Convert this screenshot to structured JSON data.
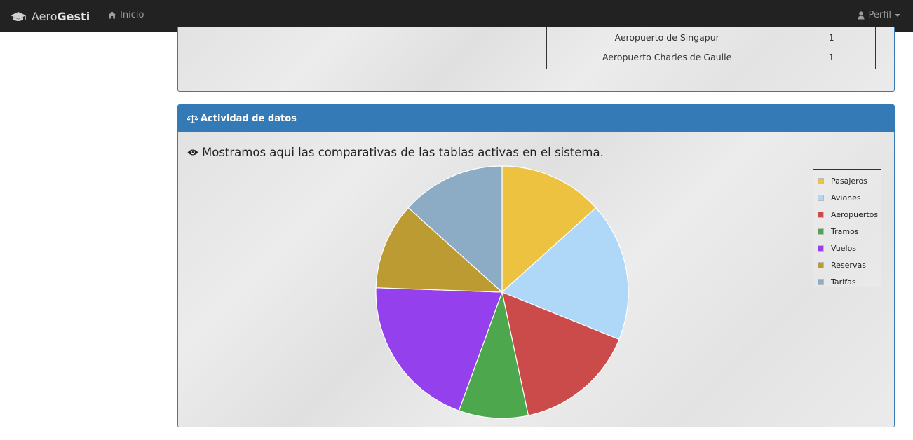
{
  "navbar": {
    "brand_prefix": "Aero",
    "brand_suffix": "Gesti",
    "home_label": "Inicio",
    "profile_label": "Perfil"
  },
  "airports_table": {
    "rows": [
      {
        "name": "Aeropuerto de Singapur",
        "count": "1"
      },
      {
        "name": "Aeropuerto Charles de Gaulle",
        "count": "1"
      }
    ]
  },
  "activity_panel": {
    "title": "Actividad de datos",
    "subtitle": "Mostramos aqui las comparativas de las tablas activas en el sistema."
  },
  "colors": {
    "primary": "#337ab7",
    "navbar": "#222222"
  },
  "chart_data": {
    "type": "pie",
    "title": "",
    "legend_position": "top-right",
    "slices": [
      {
        "label": "Pasajeros",
        "value": 3,
        "color": "#EDC240"
      },
      {
        "label": "Aviones",
        "value": 4,
        "color": "#AFD8F8"
      },
      {
        "label": "Aeropuertos",
        "value": 3.5,
        "color": "#CB4B4B"
      },
      {
        "label": "Tramos",
        "value": 2,
        "color": "#4DA74D"
      },
      {
        "label": "Vuelos",
        "value": 4.5,
        "color": "#9440ED"
      },
      {
        "label": "Reservas",
        "value": 2.5,
        "color": "#BD9B33"
      },
      {
        "label": "Tarifas",
        "value": 3,
        "color": "#8CACC6"
      }
    ]
  }
}
